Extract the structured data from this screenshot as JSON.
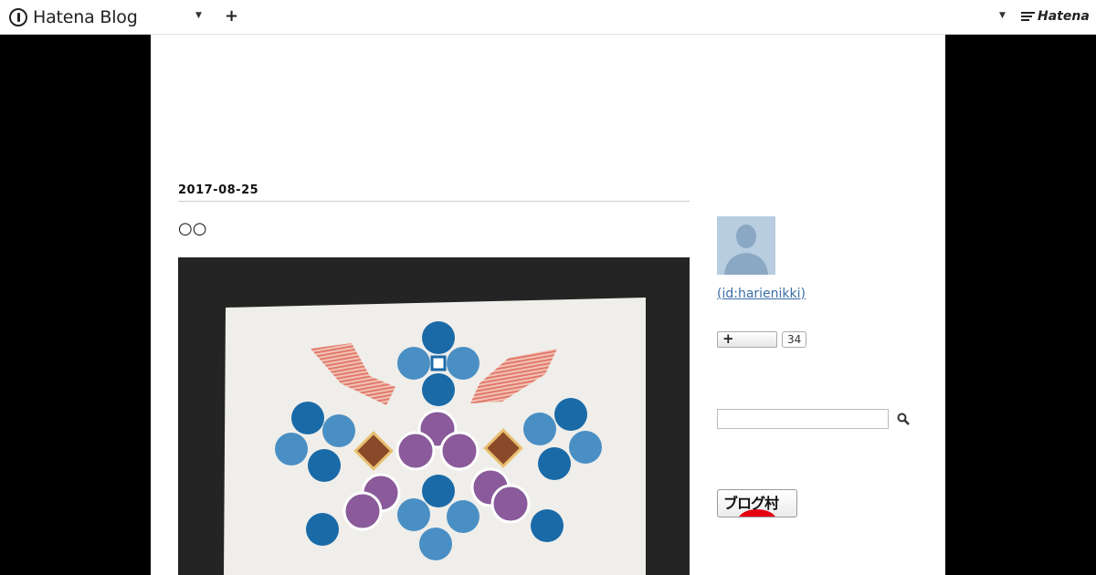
{
  "topbar": {
    "logo_text": "Hatena Blog",
    "brand_text": "Hatena"
  },
  "entry": {
    "date": "2017-08-25",
    "title": "○○"
  },
  "sidebar": {
    "user_link": " (id:harienikki)",
    "subscribe_count": "34",
    "search_placeholder": "",
    "banner_text": "ブログ村"
  },
  "icons": [
    "hatena-blog-logo-icon",
    "chevron-down-icon",
    "plus-icon",
    "hatena-logo-icon",
    "search-icon",
    "avatar-silhouette-icon"
  ]
}
